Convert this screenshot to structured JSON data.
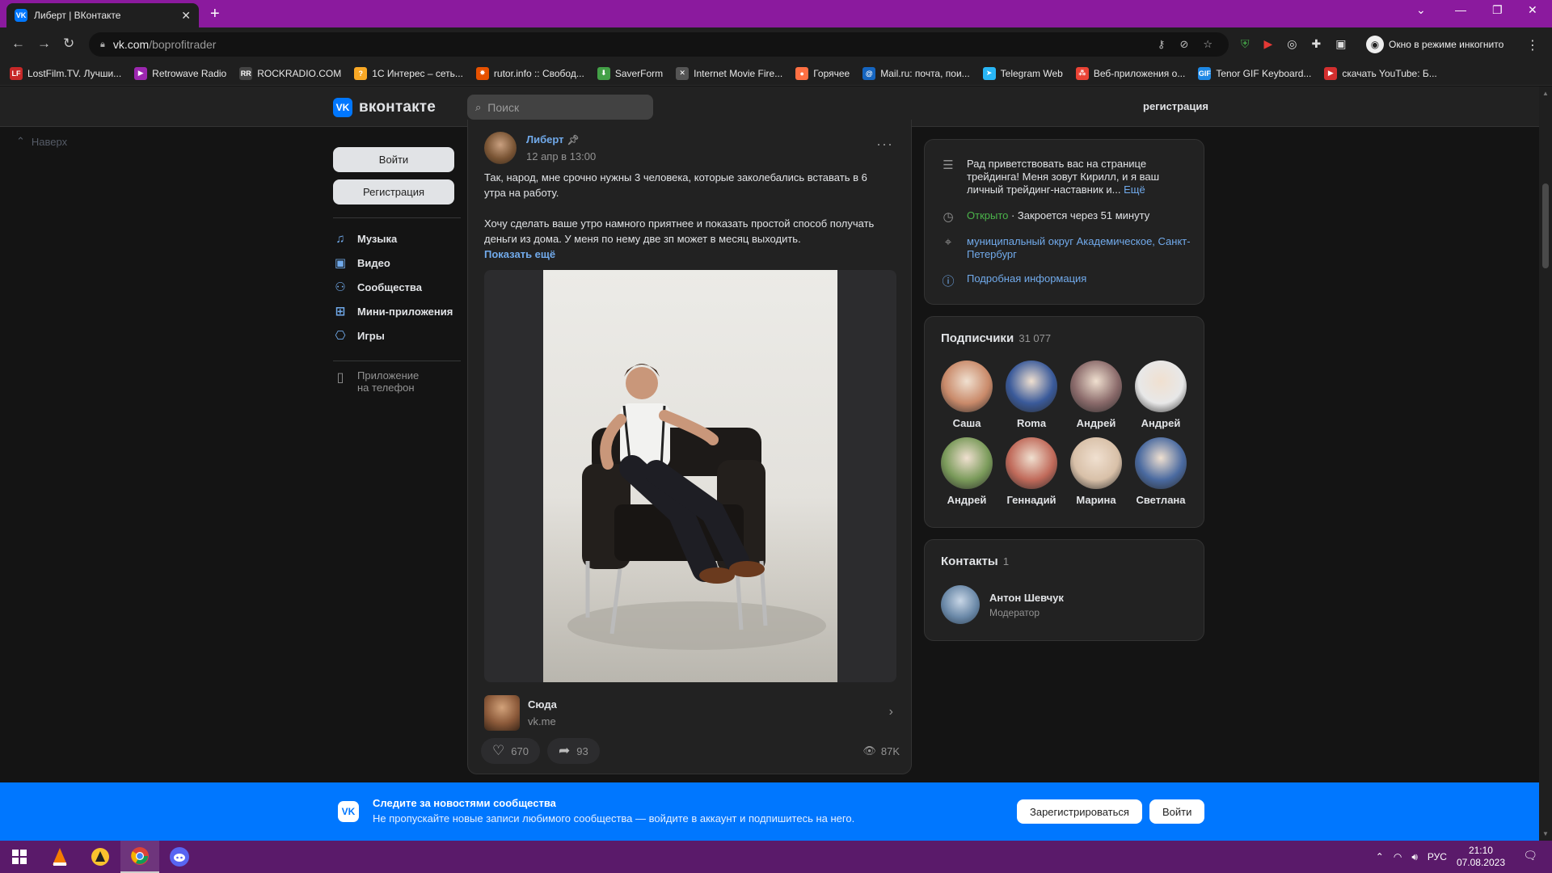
{
  "browser": {
    "tab_title": "Либерт | ВКонтакте",
    "url_host": "vk.com",
    "url_path": "/boprofitrader",
    "incognito_label": "Окно в режиме инкогнито",
    "bookmarks": [
      {
        "label": "LostFilm.TV. Лучши...",
        "icon": "lostfilm-icon",
        "color": "#c62828",
        "glyph": "LF"
      },
      {
        "label": "Retrowave Radio",
        "icon": "retrowave-icon",
        "color": "#9c27b0",
        "glyph": "▶"
      },
      {
        "label": "ROCKRADIO.COM",
        "icon": "rockradio-icon",
        "color": "#444444",
        "glyph": "RR"
      },
      {
        "label": "1С Интерес – сеть...",
        "icon": "1c-icon",
        "color": "#f9a825",
        "glyph": "?"
      },
      {
        "label": "rutor.info :: Свобод...",
        "icon": "rutor-icon",
        "color": "#e65100",
        "glyph": "✸"
      },
      {
        "label": "SaverForm",
        "icon": "saverform-icon",
        "color": "#43a047",
        "glyph": "⬇"
      },
      {
        "label": "Internet Movie Fire...",
        "icon": "imfdb-icon",
        "color": "#555555",
        "glyph": "✕"
      },
      {
        "label": "Горячее",
        "icon": "pikabu-icon",
        "color": "#ff7043",
        "glyph": "●"
      },
      {
        "label": "Mail.ru: почта, пои...",
        "icon": "mailru-icon",
        "color": "#1565c0",
        "glyph": "@"
      },
      {
        "label": "Telegram Web",
        "icon": "telegram-icon",
        "color": "#29b6f6",
        "glyph": "➤"
      },
      {
        "label": "Веб-приложения о...",
        "icon": "webapps-icon",
        "color": "#ea4335",
        "glyph": "⁂"
      },
      {
        "label": "Tenor GIF Keyboard...",
        "icon": "tenor-icon",
        "color": "#1e88e5",
        "glyph": "GIF"
      },
      {
        "label": "скачать YouTube: Б...",
        "icon": "youtube-icon",
        "color": "#d32f2f",
        "glyph": "▶"
      }
    ]
  },
  "header": {
    "logo_text": "вконтакте",
    "search_placeholder": "Поиск",
    "register_link": "регистрация"
  },
  "up_link": "Наверх",
  "left_menu": {
    "login_button": "Войти",
    "register_button": "Регистрация",
    "items": [
      {
        "label": "Музыка",
        "icon": "music-icon",
        "glyph": "♫"
      },
      {
        "label": "Видео",
        "icon": "video-icon",
        "glyph": "▣"
      },
      {
        "label": "Сообщества",
        "icon": "communities-icon",
        "glyph": "⚇"
      },
      {
        "label": "Мини-приложения",
        "icon": "mini-apps-icon",
        "glyph": "⊞"
      },
      {
        "label": "Игры",
        "icon": "games-icon",
        "glyph": "⎔"
      }
    ],
    "app_label_line1": "Приложение",
    "app_label_line2": "на телефон"
  },
  "post": {
    "author": "Либерт",
    "date": "12 апр в 13:00",
    "paragraph1": "Так, народ, мне срочно нужны 3 человека, которые заколебались вставать в 6 утра на работу.",
    "paragraph2": "Хочу сделать ваше утро намного приятнее и показать простой способ получать деньги из дома. У меня по нему две зп может в месяц выходить.",
    "show_more": "Показать ещё",
    "link_title": "Сюда",
    "link_domain": "vk.me",
    "likes": "670",
    "shares": "93",
    "views": "87K"
  },
  "info_card": {
    "description": "Рад приветствовать вас на странице трейдинга! Меня зовут Кирилл, и я ваш личный трейдинг-наставник и...",
    "more_link": "Ещё",
    "status_open": "Открыто",
    "status_close": " · Закроется через 51 минуту",
    "address": "муниципальный округ Академическое, Санкт-Петербург",
    "details_link": "Подробная информация"
  },
  "subscribers": {
    "title": "Подписчики",
    "count": "31 077",
    "people": [
      {
        "name": "Саша",
        "color": "#c98a6a"
      },
      {
        "name": "Roma",
        "color": "#3a5a9a"
      },
      {
        "name": "Андрей",
        "color": "#8a6a6a"
      },
      {
        "name": "Андрей",
        "color": "#e8e8e8"
      },
      {
        "name": "Андрей",
        "color": "#7a9a5a"
      },
      {
        "name": "Геннадий",
        "color": "#c06a5a"
      },
      {
        "name": "Марина",
        "color": "#d8c0a8"
      },
      {
        "name": "Светлана",
        "color": "#4a6aa0"
      }
    ]
  },
  "contacts": {
    "title": "Контакты",
    "count": "1",
    "name": "Антон Шевчук",
    "role": "Модератор"
  },
  "banner": {
    "title": "Следите за новостями сообщества",
    "subtitle": "Не пропускайте новые записи любимого сообщества — войдите в аккаунт и подпишитесь на него.",
    "register_button": "Зарегистрироваться",
    "login_button": "Войти"
  },
  "taskbar": {
    "language": "РУС",
    "time": "21:10",
    "date": "07.08.2023"
  },
  "colors": {
    "accent": "#0077ff",
    "link": "#71aaeb",
    "open_status": "#4bb34b",
    "browser_frame": "#8b1a9e"
  }
}
